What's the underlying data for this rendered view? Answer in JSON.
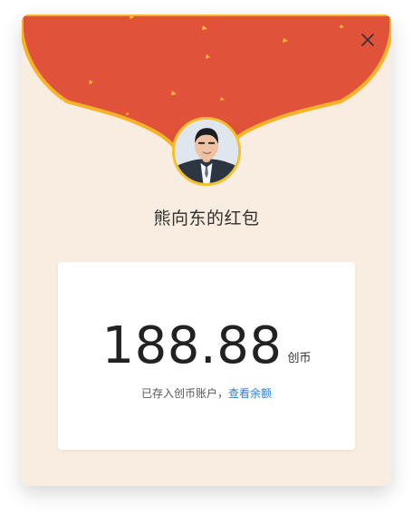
{
  "red_packet": {
    "sender_title": "熊向东的红包",
    "amount": "188.88",
    "currency": "创币",
    "deposit_message": "已存入创币账户，",
    "view_balance_link": "查看余额"
  },
  "icons": {
    "close": "close-icon",
    "avatar": "avatar"
  },
  "colors": {
    "background": "#f9ede1",
    "header_red": "#e0533a",
    "header_border": "#f6c02c",
    "card_background": "#ffffff",
    "link_blue": "#2f7dd1"
  }
}
